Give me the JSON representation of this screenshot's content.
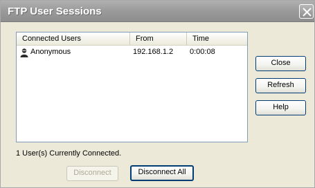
{
  "window": {
    "title": "FTP User Sessions"
  },
  "list": {
    "columns": [
      "Connected Users",
      "From",
      "Time"
    ],
    "rows": [
      {
        "user": "Anonymous",
        "from": "192.168.1.2",
        "time": "0:00:08",
        "icon": "user-icon"
      }
    ]
  },
  "buttons": {
    "close": "Close",
    "refresh": "Refresh",
    "help": "Help",
    "disconnect": "Disconnect",
    "disconnect_all": "Disconnect All"
  },
  "status": "1 User(s) Currently Connected.",
  "colors": {
    "titlebar": "#9a9a9a",
    "dialog_bg": "#ece9d8",
    "button_border": "#003c74"
  }
}
